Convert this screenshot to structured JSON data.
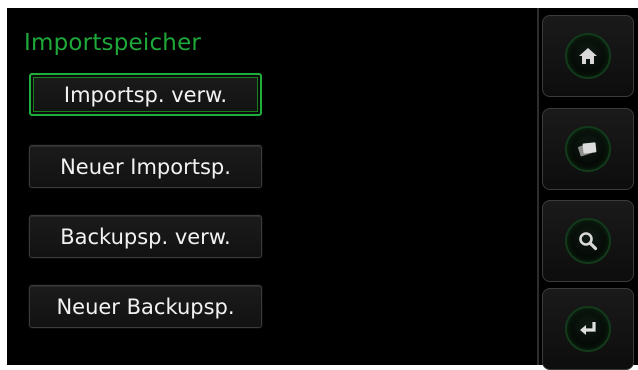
{
  "screen": {
    "title": "Importspeicher"
  },
  "menu": {
    "items": [
      {
        "label": "Importsp. verw.",
        "active": true
      },
      {
        "label": "Neuer Importsp.",
        "active": false
      },
      {
        "label": "Backupsp. verw.",
        "active": false
      },
      {
        "label": "Neuer Backupsp.",
        "active": false
      }
    ]
  },
  "sidebar": {
    "buttons": [
      {
        "icon": "home-icon"
      },
      {
        "icon": "cards-icon"
      },
      {
        "icon": "search-icon"
      },
      {
        "icon": "return-icon"
      }
    ]
  },
  "colors": {
    "accent": "#1fa83a",
    "background": "#000000",
    "text": "#f2f2f2"
  }
}
